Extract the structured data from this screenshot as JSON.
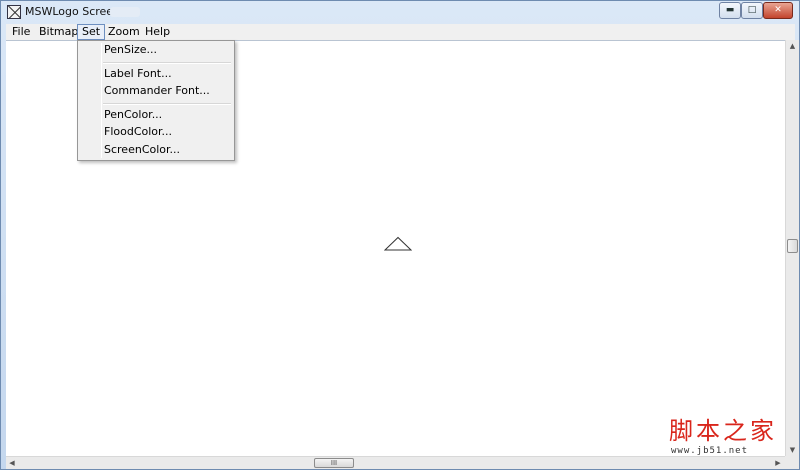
{
  "window": {
    "title": "MSWLogo Screen"
  },
  "controls": {
    "minimize": "▬",
    "maximize": "□",
    "close": "✕"
  },
  "menubar": {
    "items": [
      "File",
      "Bitmap",
      "Set",
      "Zoom",
      "Help"
    ],
    "active": "Set"
  },
  "set_menu": {
    "items": [
      "PenSize...",
      "Label Font...",
      "Commander Font...",
      "PenColor...",
      "FloodColor...",
      "ScreenColor..."
    ]
  },
  "scrollbar": {
    "thumb_grip": "III"
  },
  "watermark": {
    "brand": "脚本之家",
    "url": "www.jb51.net"
  },
  "colors": {
    "canvas": "#ffffff",
    "menu_bg": "#f0f0f0",
    "watermark": "#d9261c",
    "title_gradient_top": "#dbe8f7"
  }
}
